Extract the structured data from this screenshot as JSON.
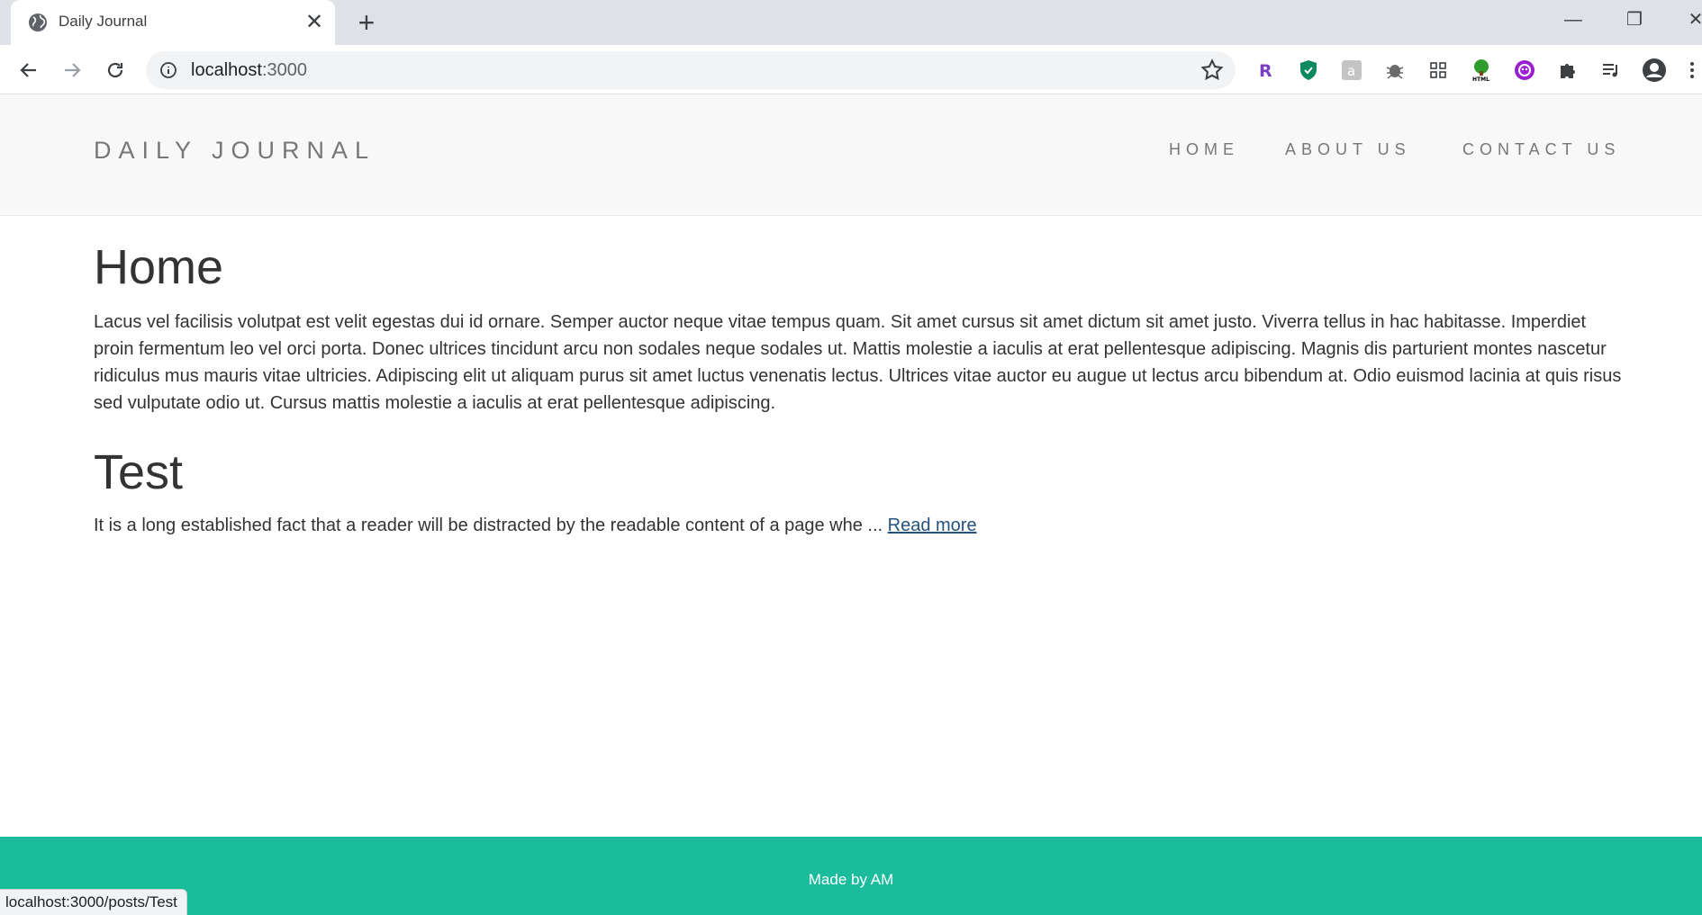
{
  "browser": {
    "tab_title": "Daily Journal",
    "tab_close": "✕",
    "new_tab": "+",
    "url_host": "localhost",
    "url_port": ":3000",
    "window_controls": {
      "minimize": "—",
      "restore": "❐",
      "close": "✕"
    },
    "extensions": [
      "r-extension-icon",
      "shield-icon",
      "puzzle-gray-icon",
      "bug-icon",
      "grid-icon",
      "html-tree-icon",
      "purple-circle-icon",
      "extensions-puzzle-icon",
      "media-queue-icon",
      "profile-icon",
      "kebab-menu-icon"
    ],
    "status_url": "localhost:3000/posts/Test"
  },
  "site": {
    "brand": "DAILY JOURNAL",
    "nav": [
      {
        "label": "HOME"
      },
      {
        "label": "ABOUT US"
      },
      {
        "label": "CONTACT US"
      }
    ]
  },
  "main": {
    "heading": "Home",
    "intro": "Lacus vel facilisis volutpat est velit egestas dui id ornare. Semper auctor neque vitae tempus quam. Sit amet cursus sit amet dictum sit amet justo. Viverra tellus in hac habitasse. Imperdiet proin fermentum leo vel orci porta. Donec ultrices tincidunt arcu non sodales neque sodales ut. Mattis molestie a iaculis at erat pellentesque adipiscing. Magnis dis parturient montes nascetur ridiculus mus mauris vitae ultricies. Adipiscing elit ut aliquam purus sit amet luctus venenatis lectus. Ultrices vitae auctor eu augue ut lectus arcu bibendum at. Odio euismod lacinia at quis risus sed vulputate odio ut. Cursus mattis molestie a iaculis at erat pellentesque adipiscing.",
    "posts": [
      {
        "title": "Test",
        "excerpt": "It is a long established fact that a reader will be distracted by the readable content of a page whe ... ",
        "read_more": "Read more"
      }
    ]
  },
  "footer": {
    "text": "Made by AM"
  },
  "colors": {
    "footer_bg": "#1abc9c",
    "header_bg": "#f8f8f8",
    "link": "#23527c"
  }
}
